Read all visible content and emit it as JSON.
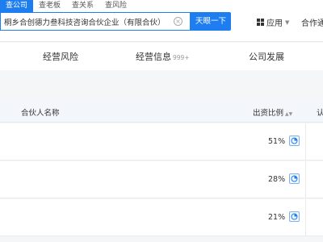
{
  "search": {
    "tabs": [
      "查公司",
      "查老板",
      "查关系",
      "查风险"
    ],
    "value": "桐乡合创德力叁科技咨询合伙企业（有限合伙）",
    "button_label": "天眼一下"
  },
  "topnav": {
    "apps_label": "应用",
    "cooperate_label": "合作通"
  },
  "sections": [
    {
      "label": "经营风险",
      "badge": ""
    },
    {
      "label": "经营信息",
      "badge": "999+"
    },
    {
      "label": "公司发展",
      "badge": ""
    }
  ],
  "table": {
    "headers": {
      "partner_name": "合伙人名称",
      "ratio": "出资比例",
      "subscribed": "认"
    },
    "rows": [
      {
        "ratio": "51%"
      },
      {
        "ratio": "28%"
      },
      {
        "ratio": "21%"
      }
    ]
  },
  "colors": {
    "accent": "#1e7ef0",
    "header_bg": "#f3f6fb",
    "page_bg": "#f5f6f8"
  }
}
